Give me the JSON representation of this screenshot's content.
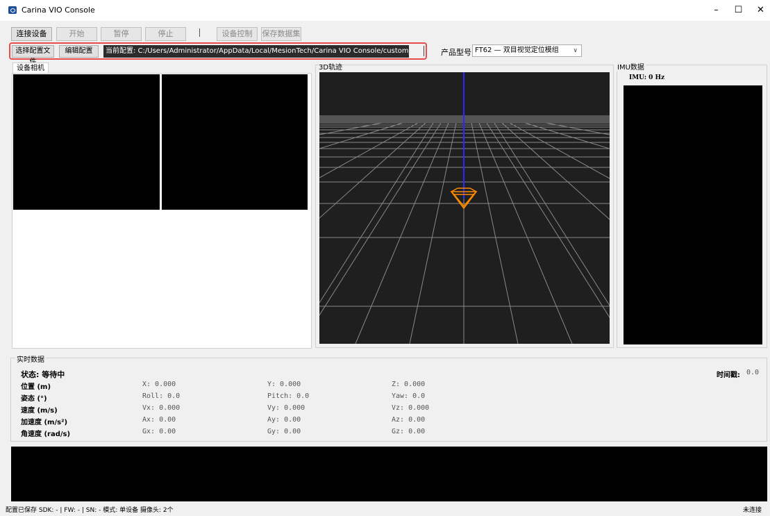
{
  "window": {
    "title": "Carina VIO Console",
    "controls": {
      "minimize": "–",
      "maximize": "☐",
      "close": "✕"
    }
  },
  "toolbar": {
    "connect": "连接设备",
    "start": "开始",
    "pause": "暂停",
    "stop": "停止",
    "separator": "|",
    "device_control": "设备控制",
    "save_dataset": "保存数据集"
  },
  "config": {
    "select_file": "选择配置文件",
    "edit": "编辑配置",
    "current_path": "当前配置: C:/Users/Administrator/AppData/Local/MesionTech/Carina VIO Console/custom_config.yaml"
  },
  "product": {
    "label": "产品型号:",
    "selected": "FT62 — 双目视觉定位模组"
  },
  "camera": {
    "tab_label": "设备相机"
  },
  "trajectory": {
    "label": "3D轨迹"
  },
  "imu": {
    "label": "IMU数据",
    "rate": "IMU: 0 Hz"
  },
  "realtime": {
    "title": "实时数据",
    "status": "状态: 等待中",
    "timestamp_label": "时间戳:",
    "timestamp_value": "0.0",
    "rows": [
      {
        "label": "位置 (m)",
        "v1": "X: 0.000",
        "v2": "Y: 0.000",
        "v3": "Z: 0.000"
      },
      {
        "label": "姿态 (°)",
        "v1": "Roll: 0.0",
        "v2": "Pitch: 0.0",
        "v3": "Yaw: 0.0"
      },
      {
        "label": "速度 (m/s)",
        "v1": "Vx: 0.000",
        "v2": "Vy: 0.000",
        "v3": "Vz: 0.000"
      },
      {
        "label": "加速度 (m/s²)",
        "v1": "Ax: 0.00",
        "v2": "Ay: 0.00",
        "v3": "Az: 0.00"
      },
      {
        "label": "角速度 (rad/s)",
        "v1": "Gx: 0.00",
        "v2": "Gy: 0.00",
        "v3": "Gz: 0.00"
      }
    ]
  },
  "statusbar": {
    "left": "配置已保存 SDK: - | FW: - | SN: - 模式: 单设备 摄像头: 2个",
    "right": "未连接"
  },
  "colors": {
    "highlight": "#e74c4c",
    "axis": "#2a2aff",
    "camera_marker": "#ff8c00"
  }
}
